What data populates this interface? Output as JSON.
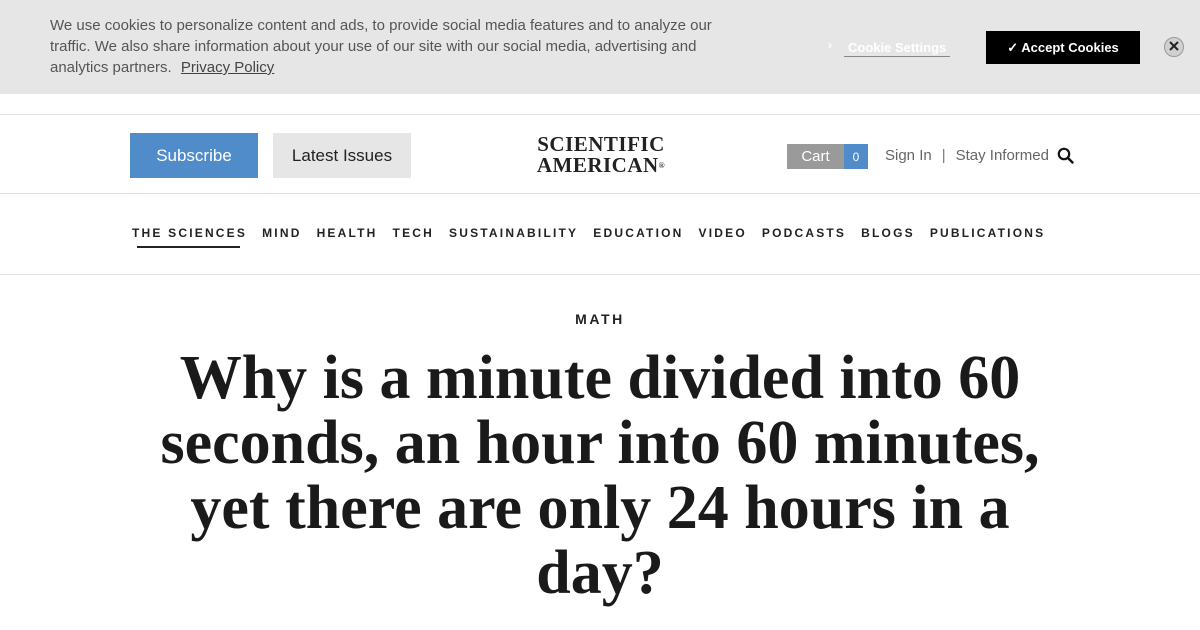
{
  "cookie_banner": {
    "message": "We use cookies to personalize content and ads, to provide social media features and to analyze our traffic. We also share information about your use of our site with our social media, advertising and analytics partners.",
    "privacy_link": "Privacy Policy",
    "settings_chevron": "›",
    "settings_label": "Cookie Settings",
    "accept_label": "✓ Accept Cookies",
    "close_glyph": "✕"
  },
  "header": {
    "subscribe_label": "Subscribe",
    "latest_issues_label": "Latest Issues",
    "logo_line1": "SCIENTIFIC",
    "logo_line2": "AMERICAN",
    "logo_mark": "®",
    "cart_label": "Cart",
    "cart_count": "0",
    "sign_in_label": "Sign In",
    "separator": "|",
    "stay_informed_label": "Stay Informed",
    "search_icon": "search-icon"
  },
  "nav": {
    "items": [
      {
        "label": "THE SCIENCES",
        "active": true
      },
      {
        "label": "MIND"
      },
      {
        "label": "HEALTH"
      },
      {
        "label": "TECH"
      },
      {
        "label": "SUSTAINABILITY"
      },
      {
        "label": "EDUCATION"
      },
      {
        "label": "VIDEO"
      },
      {
        "label": "PODCASTS"
      },
      {
        "label": "BLOGS"
      },
      {
        "label": "PUBLICATIONS"
      }
    ]
  },
  "article": {
    "category": "MATH",
    "headline": "Why is a minute divided into 60 seconds, an hour into 60 minutes, yet there are only 24 hours in a day?"
  },
  "colors": {
    "accent": "#4f8cc9",
    "banner_bg": "#e6e6e6",
    "accept_bg": "#000000",
    "cart_bg": "#9a9a9a"
  }
}
